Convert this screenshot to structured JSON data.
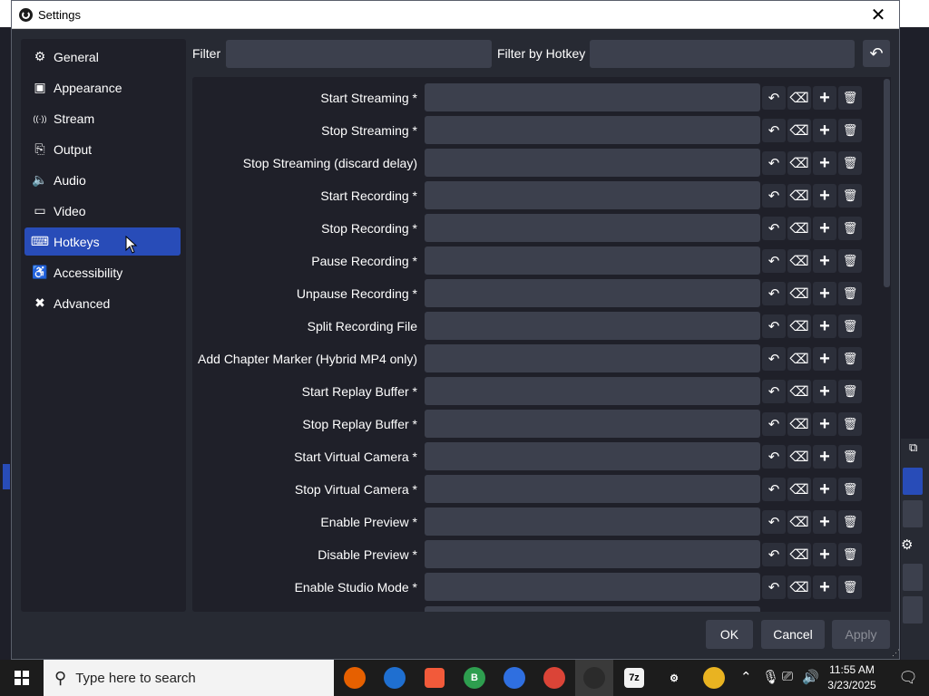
{
  "window": {
    "title": "Settings",
    "close_glyph": "✕"
  },
  "sidebar": {
    "items": [
      {
        "label": "General",
        "icon": "gear-icon",
        "glyph": "⚙",
        "active": false
      },
      {
        "label": "Appearance",
        "icon": "palette-icon",
        "glyph": "▣",
        "active": false
      },
      {
        "label": "Stream",
        "icon": "broadcast-icon",
        "glyph": "((·))",
        "active": false
      },
      {
        "label": "Output",
        "icon": "output-icon",
        "glyph": "⎘",
        "active": false
      },
      {
        "label": "Audio",
        "icon": "speaker-icon",
        "glyph": "🔈",
        "active": false
      },
      {
        "label": "Video",
        "icon": "monitor-icon",
        "glyph": "▭",
        "active": false
      },
      {
        "label": "Hotkeys",
        "icon": "keyboard-icon",
        "glyph": "⌨",
        "active": true
      },
      {
        "label": "Accessibility",
        "icon": "accessibility-icon",
        "glyph": "♿",
        "active": false
      },
      {
        "label": "Advanced",
        "icon": "wrench-icon",
        "glyph": "✖",
        "active": false
      }
    ]
  },
  "filters": {
    "filter_label": "Filter",
    "filter_value": "",
    "hotkey_label": "Filter by Hotkey",
    "hotkey_value": ""
  },
  "hotkeys": [
    {
      "label": "Start Streaming *",
      "value": ""
    },
    {
      "label": "Stop Streaming *",
      "value": ""
    },
    {
      "label": "Stop Streaming (discard delay)",
      "value": ""
    },
    {
      "label": "Start Recording *",
      "value": ""
    },
    {
      "label": "Stop Recording *",
      "value": ""
    },
    {
      "label": "Pause Recording *",
      "value": ""
    },
    {
      "label": "Unpause Recording *",
      "value": ""
    },
    {
      "label": "Split Recording File",
      "value": ""
    },
    {
      "label": "Add Chapter Marker (Hybrid MP4 only)",
      "value": ""
    },
    {
      "label": "Start Replay Buffer *",
      "value": ""
    },
    {
      "label": "Stop Replay Buffer *",
      "value": ""
    },
    {
      "label": "Start Virtual Camera *",
      "value": ""
    },
    {
      "label": "Stop Virtual Camera *",
      "value": ""
    },
    {
      "label": "Enable Preview *",
      "value": ""
    },
    {
      "label": "Disable Preview *",
      "value": ""
    },
    {
      "label": "Enable Studio Mode *",
      "value": ""
    }
  ],
  "row_buttons": [
    {
      "name": "revert-icon",
      "glyph": "↶"
    },
    {
      "name": "clear-icon",
      "glyph": "⌫"
    },
    {
      "name": "add-icon",
      "glyph": "+"
    },
    {
      "name": "delete-icon",
      "glyph": "🗑"
    }
  ],
  "buttons": {
    "ok": "OK",
    "cancel": "Cancel",
    "apply": "Apply"
  },
  "taskbar": {
    "search_placeholder": "Type here to search",
    "apps": [
      {
        "name": "firefox-icon",
        "color": "#e66000",
        "text": ""
      },
      {
        "name": "browser-icon",
        "color": "#1f6fd0",
        "text": ""
      },
      {
        "name": "app-red-icon",
        "color": "#f25a3a",
        "text": ""
      },
      {
        "name": "chrome-beta-icon",
        "color": "#2e9e4f",
        "text": "B"
      },
      {
        "name": "firefox-dev-icon",
        "color": "#2f6fe0",
        "text": ""
      },
      {
        "name": "chrome-icon",
        "color": "#db4437",
        "text": ""
      },
      {
        "name": "obs-icon",
        "color": "#2b2b2b",
        "text": ""
      },
      {
        "name": "7zip-icon",
        "color": "#f2f2f2",
        "text": "7z"
      },
      {
        "name": "settings-icon",
        "color": "#1c1c1c",
        "text": "⚙"
      },
      {
        "name": "app-orange-icon",
        "color": "#e9b321",
        "text": ""
      }
    ],
    "time": "11:55 AM",
    "date": "3/23/2025"
  }
}
